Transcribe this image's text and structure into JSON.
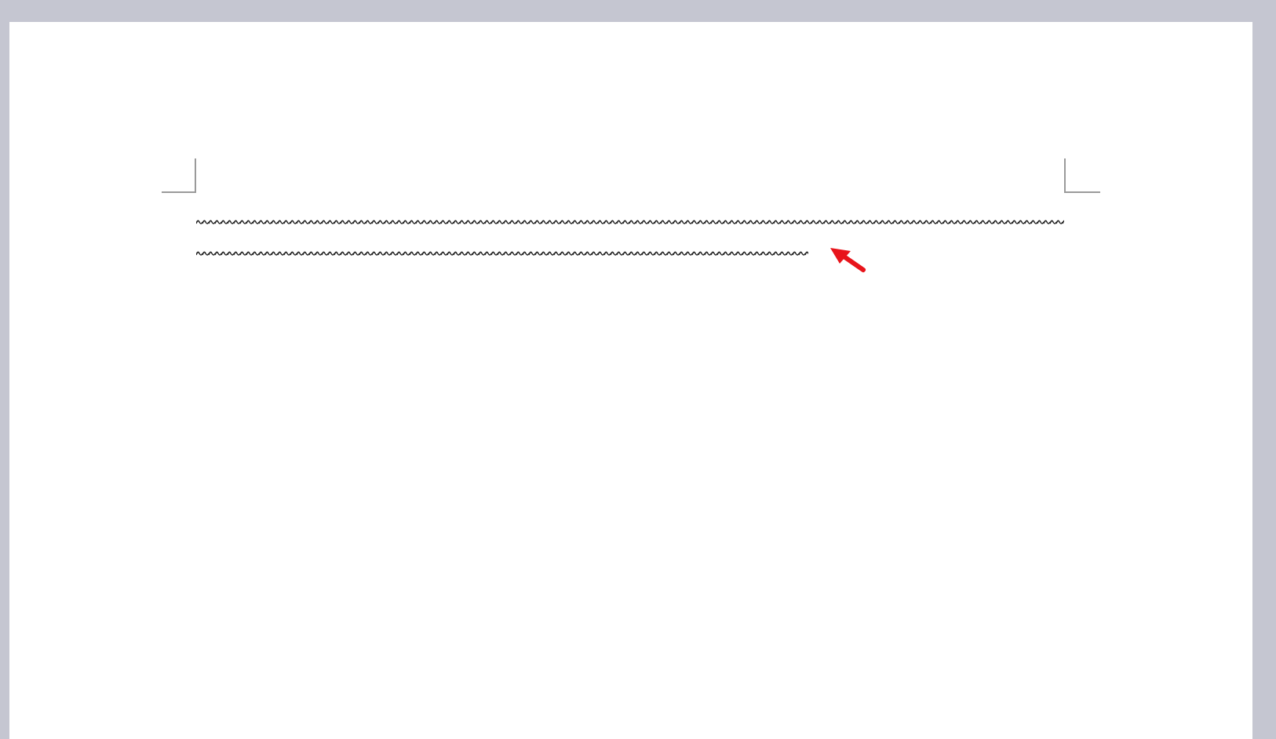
{
  "document": {
    "corner_marks": true,
    "wavy_lines": [
      {
        "kind": "full"
      },
      {
        "kind": "partial"
      }
    ]
  },
  "annotation": {
    "kind": "arrow",
    "color": "#e8141b"
  }
}
